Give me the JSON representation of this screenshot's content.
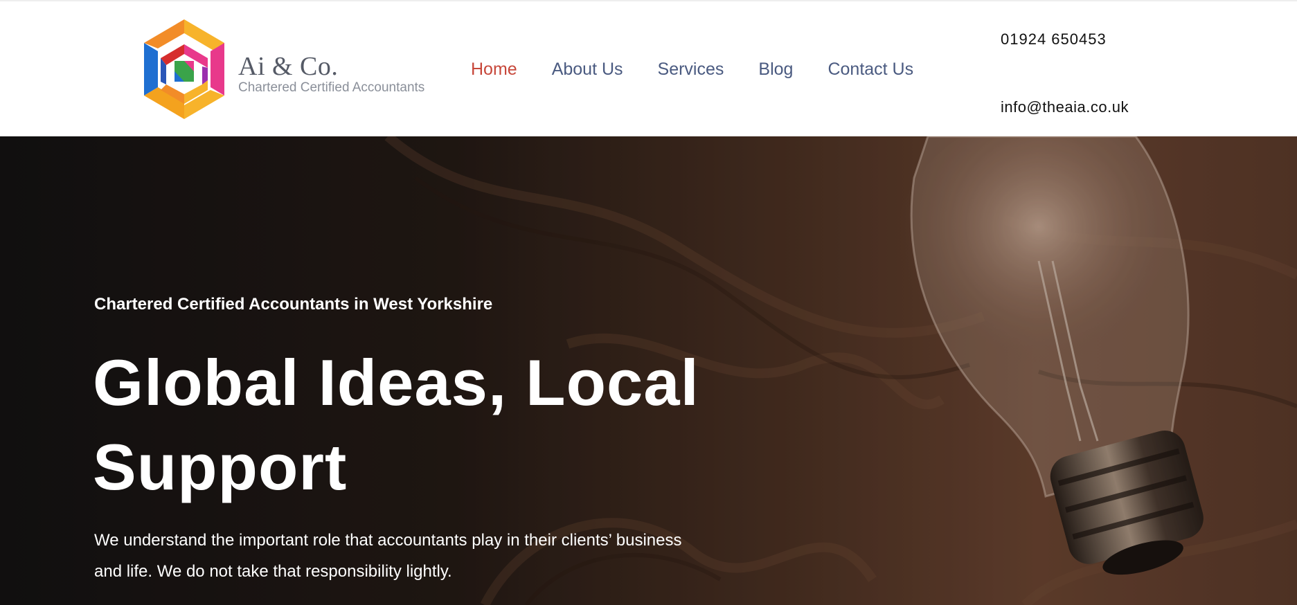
{
  "brand": {
    "name": "Ai & Co.",
    "tagline": "Chartered Certified Accountants",
    "logo_icon": "hexagon-logo-icon",
    "colors": [
      "#f7b32b",
      "#e8398b",
      "#1f6fd1",
      "#3aa34a",
      "#f28c28"
    ]
  },
  "nav": {
    "items": [
      {
        "label": "Home",
        "active": true
      },
      {
        "label": "About Us",
        "active": false
      },
      {
        "label": "Services",
        "active": false
      },
      {
        "label": "Blog",
        "active": false
      },
      {
        "label": "Contact Us",
        "active": false
      }
    ],
    "active_color": "#c7473a",
    "color": "#4a5a80"
  },
  "contact": {
    "phone": "01924 650453",
    "email": "info@theaia.co.uk"
  },
  "hero": {
    "kicker": "Chartered Certified Accountants in West Yorkshire",
    "title_line1": "Global Ideas, Local",
    "title_line2": "Support",
    "text": "We understand the important role that accountants play in their clients’ business and life. We do not take that responsibility lightly.",
    "background_image": "lightbulb-on-wood-image"
  }
}
